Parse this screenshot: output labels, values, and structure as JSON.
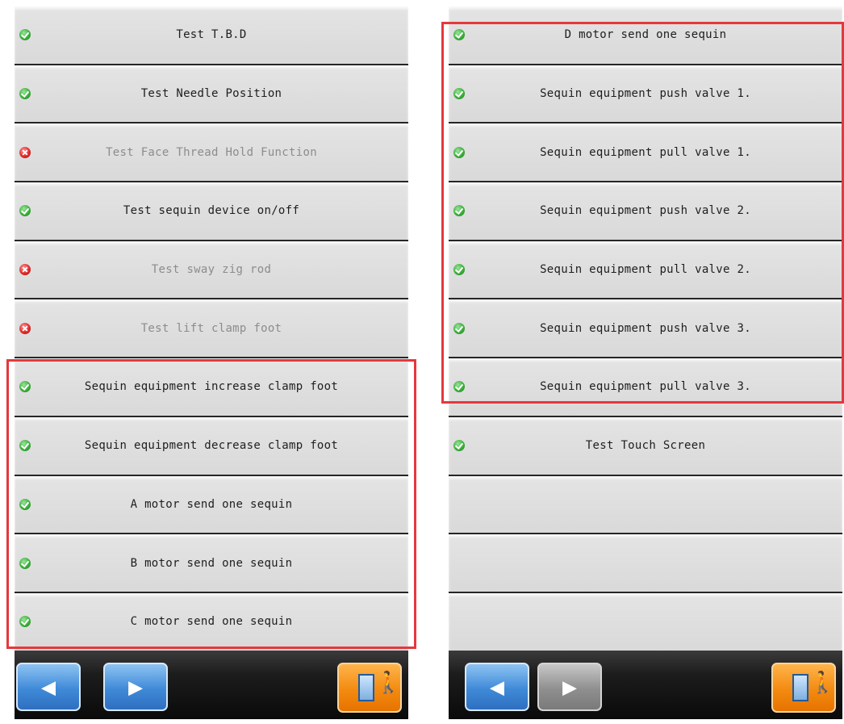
{
  "left_panel": {
    "items": [
      {
        "label": "Test T.B.D",
        "status": "ok"
      },
      {
        "label": "Test Needle Position",
        "status": "ok"
      },
      {
        "label": "Test Face Thread Hold Function",
        "status": "error"
      },
      {
        "label": "Test sequin device on/off",
        "status": "ok"
      },
      {
        "label": "Test sway zig rod",
        "status": "error"
      },
      {
        "label": "Test lift clamp foot",
        "status": "error"
      },
      {
        "label": "Sequin equipment increase clamp foot",
        "status": "ok"
      },
      {
        "label": "Sequin equipment decrease clamp foot",
        "status": "ok"
      },
      {
        "label": "A motor send one sequin",
        "status": "ok"
      },
      {
        "label": "B motor send one sequin",
        "status": "ok"
      },
      {
        "label": "C motor send one sequin",
        "status": "ok"
      }
    ],
    "prev_button": {
      "icon": "arrow-left-icon",
      "symbol": "◀",
      "enabled": true
    },
    "next_button": {
      "icon": "arrow-right-icon",
      "symbol": "▶",
      "enabled": true
    },
    "exit_button": {
      "icon": "exit-door-icon",
      "person_symbol": "🚶"
    }
  },
  "right_panel": {
    "items": [
      {
        "label": "D motor send one sequin",
        "status": "ok"
      },
      {
        "label": "Sequin equipment push valve 1.",
        "status": "ok"
      },
      {
        "label": "Sequin equipment pull valve 1.",
        "status": "ok"
      },
      {
        "label": "Sequin equipment push valve 2.",
        "status": "ok"
      },
      {
        "label": "Sequin equipment pull valve 2.",
        "status": "ok"
      },
      {
        "label": "Sequin equipment push valve 3.",
        "status": "ok"
      },
      {
        "label": "Sequin equipment pull valve 3.",
        "status": "ok"
      },
      {
        "label": "Test Touch Screen",
        "status": "ok"
      },
      {
        "label": "",
        "status": "none"
      },
      {
        "label": "",
        "status": "none"
      },
      {
        "label": "",
        "status": "none"
      }
    ],
    "prev_button": {
      "icon": "arrow-left-icon",
      "symbol": "◀",
      "enabled": true
    },
    "next_button": {
      "icon": "arrow-right-icon",
      "symbol": "▶",
      "enabled": false
    },
    "exit_button": {
      "icon": "exit-door-icon",
      "person_symbol": "🚶"
    }
  },
  "colors": {
    "highlight": "#e5383d",
    "ok_icon": "#3dae3d",
    "error_icon": "#e02a2a",
    "disabled_text": "#8c8c8c",
    "nav_blue": "#3f8ad8",
    "nav_gray": "#8f8f8f",
    "exit_orange": "#f38a10"
  }
}
